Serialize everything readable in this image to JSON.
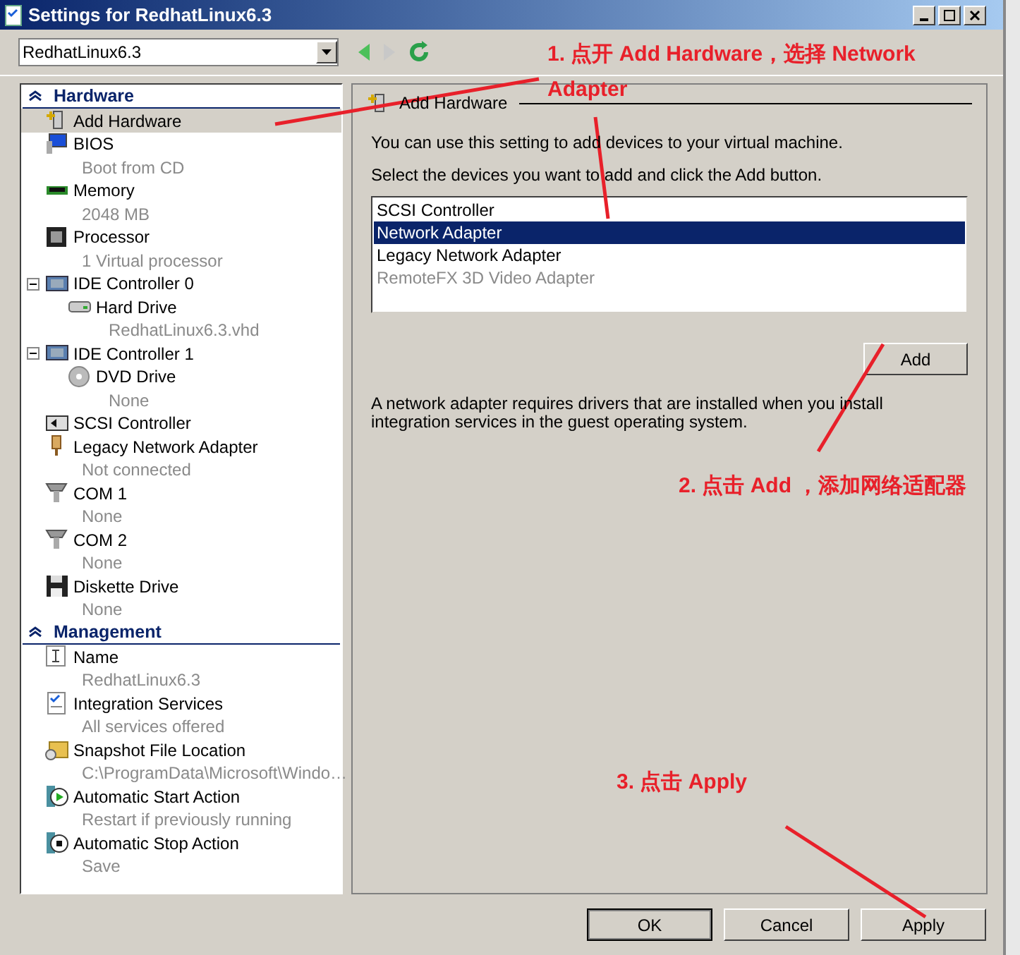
{
  "window": {
    "title": "Settings for RedhatLinux6.3"
  },
  "vm_selector": {
    "value": "RedhatLinux6.3"
  },
  "sections": [
    {
      "title": "Hardware",
      "expanded": true,
      "items": [
        {
          "name": "Add Hardware",
          "selected": true
        },
        {
          "name": "BIOS",
          "detail": "Boot from CD",
          "selected": false
        },
        {
          "name": "Memory",
          "detail": "2048 MB",
          "selected": false
        },
        {
          "name": "Processor",
          "detail": "1 Virtual processor",
          "selected": false
        },
        {
          "name": "IDE Controller 0",
          "selected": false,
          "expanded": true,
          "children": [
            {
              "name": "Hard Drive",
              "detail": "RedhatLinux6.3.vhd",
              "selected": false
            }
          ]
        },
        {
          "name": "IDE Controller 1",
          "selected": false,
          "expanded": true,
          "children": [
            {
              "name": "DVD Drive",
              "detail": "None",
              "selected": false
            }
          ]
        },
        {
          "name": "SCSI Controller",
          "selected": false
        },
        {
          "name": "Legacy Network Adapter",
          "detail": "Not connected",
          "selected": false
        },
        {
          "name": "COM 1",
          "detail": "None",
          "selected": false
        },
        {
          "name": "COM 2",
          "detail": "None",
          "selected": false
        },
        {
          "name": "Diskette Drive",
          "detail": "None",
          "selected": false
        }
      ]
    },
    {
      "title": "Management",
      "expanded": true,
      "items": [
        {
          "name": "Name",
          "detail": "RedhatLinux6.3",
          "selected": false
        },
        {
          "name": "Integration Services",
          "detail": "All services offered",
          "selected": false
        },
        {
          "name": "Snapshot File Location",
          "detail": "C:\\ProgramData\\Microsoft\\Windo…",
          "selected": false
        },
        {
          "name": "Automatic Start Action",
          "detail": "Restart if previously running",
          "selected": false
        },
        {
          "name": "Automatic Stop Action",
          "detail": "Save",
          "selected": false
        }
      ]
    }
  ],
  "panel": {
    "title": "Add Hardware",
    "intro": "You can use this setting to add devices to your virtual machine.",
    "instruction": "Select the devices you want to add and click the Add button.",
    "devices": [
      {
        "label": "SCSI Controller",
        "selected": false,
        "disabled": false
      },
      {
        "label": "Network Adapter",
        "selected": true,
        "disabled": false
      },
      {
        "label": "Legacy Network Adapter",
        "selected": false,
        "disabled": false
      },
      {
        "label": "RemoteFX 3D Video Adapter",
        "selected": false,
        "disabled": true
      }
    ],
    "add_button": "Add",
    "note": "A network adapter requires drivers that are installed when you install integration services in the guest operating system."
  },
  "buttons": [
    {
      "label": "OK",
      "default": true
    },
    {
      "label": "Cancel",
      "default": false
    },
    {
      "label": "Apply",
      "default": false
    }
  ],
  "annotations": [
    {
      "lines": [
        "1. 点开 Add Hardware，选择 Network",
        "Adapter"
      ]
    },
    {
      "lines": [
        "2. 点击 Add ，添加网络适配器"
      ]
    },
    {
      "lines": [
        "3. 点击 Apply"
      ]
    }
  ]
}
